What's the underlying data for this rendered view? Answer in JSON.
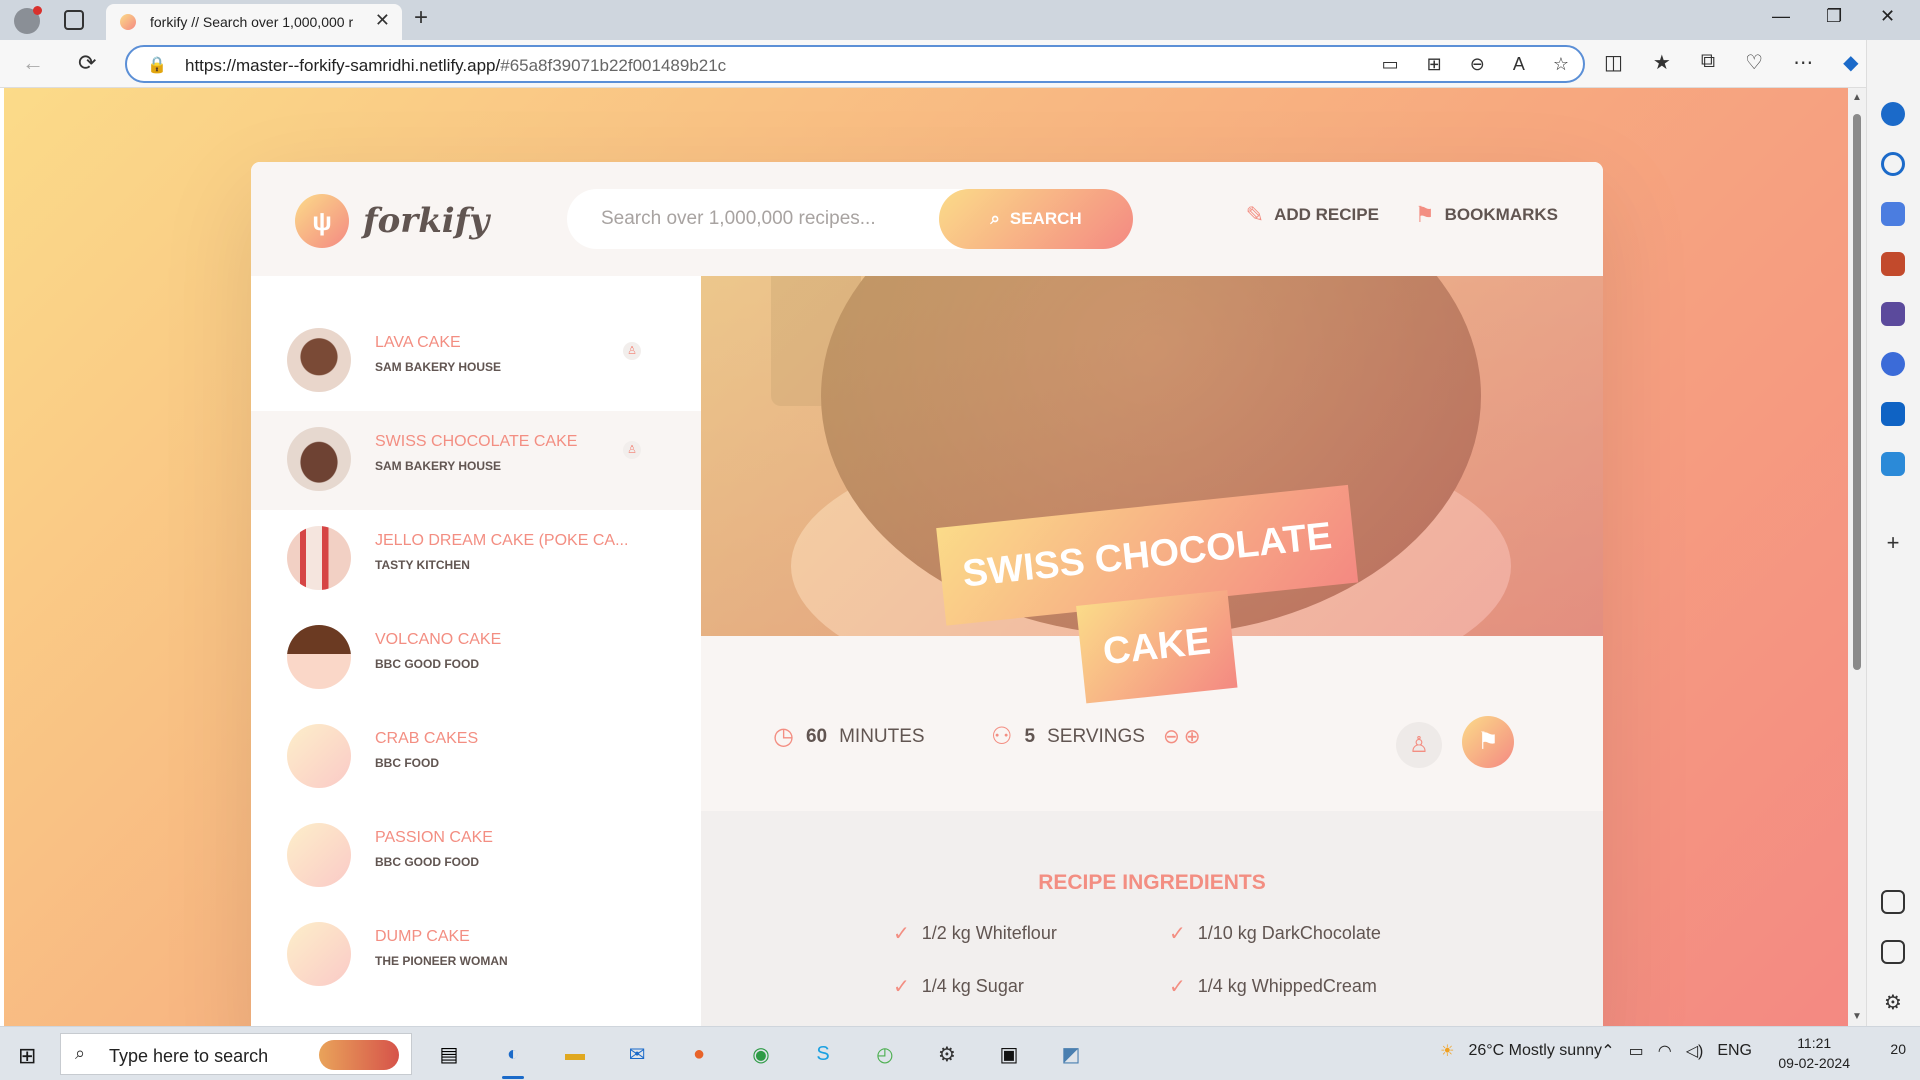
{
  "browser": {
    "tab_title": "forkify // Search over 1,000,000 r",
    "url_host": "https://master--forkify-samridhi.netlify.app/",
    "url_path": "#65a8f39071b22f001489b21c"
  },
  "app": {
    "logo_text": "forkify",
    "search_placeholder": "Search over 1,000,000 recipes...",
    "search_button": "SEARCH",
    "add_recipe": "ADD RECIPE",
    "bookmarks": "BOOKMARKS"
  },
  "results": [
    {
      "name": "LAVA CAKE",
      "publisher": "SAM BAKERY HOUSE",
      "user": true
    },
    {
      "name": "SWISS CHOCOLATE CAKE",
      "publisher": "SAM BAKERY HOUSE",
      "user": true
    },
    {
      "name": "JELLO DREAM CAKE (POKE CA...",
      "publisher": "TASTY KITCHEN",
      "user": false
    },
    {
      "name": "VOLCANO CAKE",
      "publisher": "BBC GOOD FOOD",
      "user": false
    },
    {
      "name": "CRAB CAKES",
      "publisher": "BBC FOOD",
      "user": false
    },
    {
      "name": "PASSION CAKE",
      "publisher": "BBC GOOD FOOD",
      "user": false
    },
    {
      "name": "DUMP CAKE",
      "publisher": "THE PIONEER WOMAN",
      "user": false
    }
  ],
  "recipe": {
    "title_line1": "SWISS CHOCOLATE",
    "title_line2": "CAKE",
    "minutes": "60",
    "minutes_label": "MINUTES",
    "servings": "5",
    "servings_label": "SERVINGS",
    "ingredients_heading": "RECIPE INGREDIENTS",
    "ingredients": [
      "1/2 kg Whiteflour",
      "1/10 kg DarkChocolate",
      "1/4 kg Sugar",
      "1/4 kg WhippedCream"
    ]
  },
  "taskbar": {
    "search_text": "Type here to search",
    "weather": "26°C  Mostly sunny",
    "lang": "ENG",
    "time": "11:21",
    "date": "09-02-2024",
    "notifications": "20"
  },
  "colors": {
    "accent": "#f38e82",
    "gradient_start": "#fbdb89",
    "gradient_end": "#f48982",
    "text": "#615551"
  }
}
